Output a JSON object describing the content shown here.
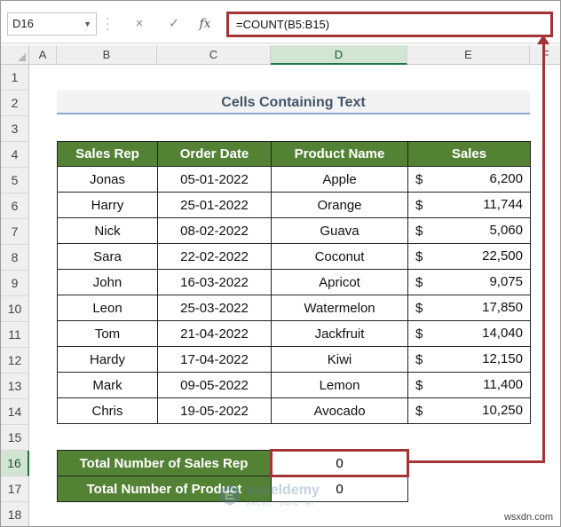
{
  "formula_bar": {
    "name_box": "D16",
    "cancel_icon": "×",
    "enter_icon": "✓",
    "fx_label": "fx",
    "formula": "=COUNT(B5:B15)"
  },
  "columns": [
    "A",
    "B",
    "C",
    "D",
    "E",
    "F"
  ],
  "selected_column": "D",
  "rows": [
    "1",
    "2",
    "3",
    "4",
    "5",
    "6",
    "7",
    "8",
    "9",
    "10",
    "11",
    "12",
    "13",
    "14",
    "15",
    "16",
    "17",
    "18"
  ],
  "selected_row": "16",
  "title": "Cells Containing Text",
  "table": {
    "headers": [
      "Sales Rep",
      "Order Date",
      "Product Name",
      "Sales"
    ],
    "rows": [
      {
        "rep": "Jonas",
        "date": "05-01-2022",
        "product": "Apple",
        "currency": "$",
        "sales": "6,200"
      },
      {
        "rep": "Harry",
        "date": "25-01-2022",
        "product": "Orange",
        "currency": "$",
        "sales": "11,744"
      },
      {
        "rep": "Nick",
        "date": "08-02-2022",
        "product": "Guava",
        "currency": "$",
        "sales": "5,060"
      },
      {
        "rep": "Sara",
        "date": "22-02-2022",
        "product": "Coconut",
        "currency": "$",
        "sales": "22,500"
      },
      {
        "rep": "John",
        "date": "16-03-2022",
        "product": "Apricot",
        "currency": "$",
        "sales": "9,075"
      },
      {
        "rep": "Leon",
        "date": "25-03-2022",
        "product": "Watermelon",
        "currency": "$",
        "sales": "17,850"
      },
      {
        "rep": "Tom",
        "date": "21-04-2022",
        "product": "Jackfruit",
        "currency": "$",
        "sales": "14,040"
      },
      {
        "rep": "Hardy",
        "date": "17-04-2022",
        "product": "Kiwi",
        "currency": "$",
        "sales": "12,150"
      },
      {
        "rep": "Mark",
        "date": "09-05-2022",
        "product": "Lemon",
        "currency": "$",
        "sales": "11,400"
      },
      {
        "rep": "Chris",
        "date": "19-05-2022",
        "product": "Avocado",
        "currency": "$",
        "sales": "10,250"
      }
    ]
  },
  "summary": [
    {
      "label": "Total Number of Sales Rep",
      "value": "0"
    },
    {
      "label": "Total Number of Product",
      "value": "0"
    }
  ],
  "watermark": {
    "name": "exceldemy",
    "tagline": "EXCEL · DATA · BI"
  },
  "credit": "wsxdn.com",
  "colors": {
    "header_green": "#548235",
    "highlight_red": "#a33436",
    "title_text": "#44546a"
  }
}
